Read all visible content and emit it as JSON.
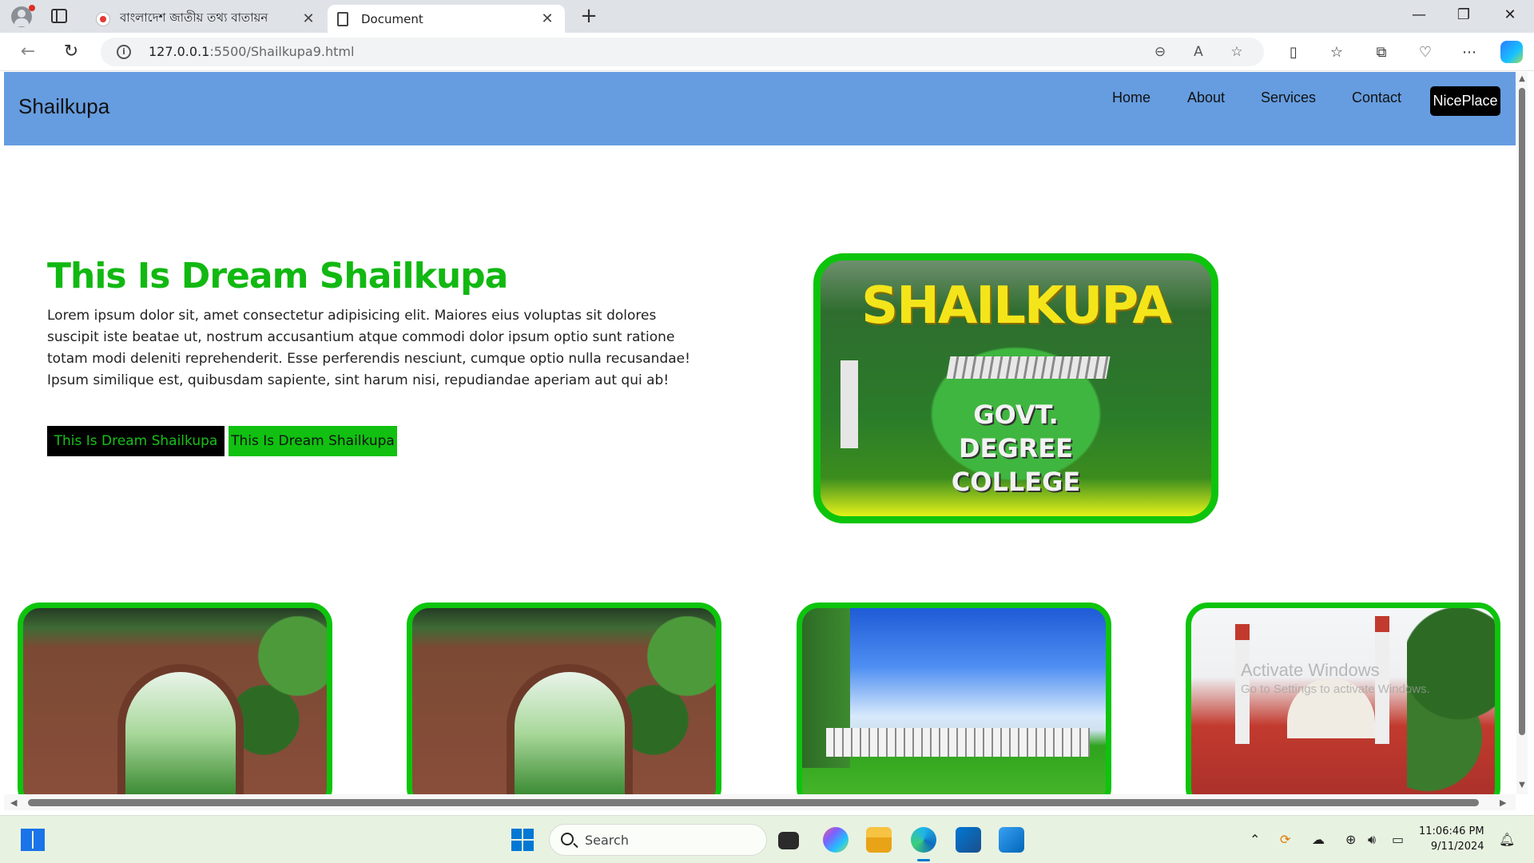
{
  "browser": {
    "tabs": [
      {
        "title": "বাংলাদেশ জাতীয় তথ্য বাতায়ন",
        "icon": "bangladesh-flag-icon"
      },
      {
        "title": "Document",
        "icon": "document-icon"
      }
    ],
    "url_host": "127.0.0.1",
    "url_path": ":5500/Shailkupa9.html"
  },
  "site": {
    "brand": "Shailkupa",
    "nav": [
      "Home",
      "About",
      "Services",
      "Contact"
    ],
    "nav_button": "NicePlace",
    "nav_color": "#669de0"
  },
  "hero": {
    "title": "This Is Dream Shailkupa",
    "text": "Lorem ipsum dolor sit, amet consectetur adipisicing elit. Maiores eius voluptas sit dolores suscipit iste beatae ut, nostrum accusantium atque commodi dolor ipsum optio sunt ratione totam modi deleniti reprehenderit. Esse perferendis nesciunt, cumque optio nulla recusandae! Ipsum similique est, quibusdam sapiente, sint harum nisi, repudiandae aperiam aut qui ab!",
    "button_primary": "This Is Dream Shailkupa",
    "button_secondary": "This Is Dream Shailkupa",
    "image_title": "SHAILKUPA",
    "image_subtitle_1": "GOVT.",
    "image_subtitle_2": "DEGREE",
    "image_subtitle_3": "COLLEGE",
    "accent": "#12b812"
  },
  "watermark": {
    "line1": "Activate Windows",
    "line2": "Go to Settings to activate Windows."
  },
  "taskbar": {
    "search_label": "Search",
    "time": "11:06:46 PM",
    "date": "9/11/2024"
  }
}
